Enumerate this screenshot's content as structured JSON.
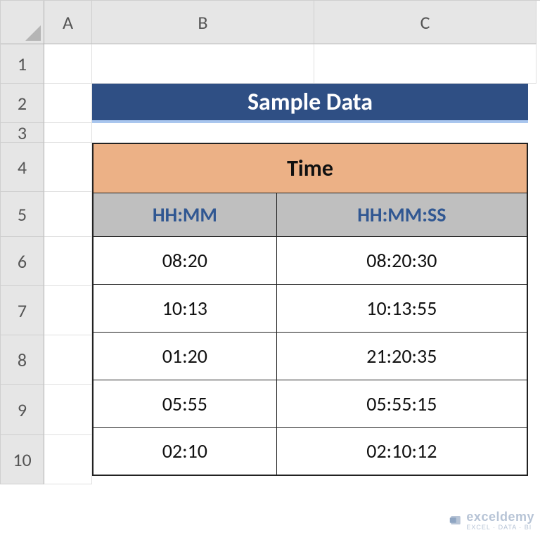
{
  "columns": [
    "A",
    "B",
    "C"
  ],
  "rows": [
    "1",
    "2",
    "3",
    "4",
    "5",
    "6",
    "7",
    "8",
    "9",
    "10"
  ],
  "title": "Sample Data",
  "table": {
    "header": "Time",
    "sub_headers": [
      "HH:MM",
      "HH:MM:SS"
    ],
    "data": [
      {
        "hhmm": "08:20",
        "hhmmss": "08:20:30"
      },
      {
        "hhmm": "10:13",
        "hhmmss": "10:13:55"
      },
      {
        "hhmm": "01:20",
        "hhmmss": "21:20:35"
      },
      {
        "hhmm": "05:55",
        "hhmmss": "05:55:15"
      },
      {
        "hhmm": "02:10",
        "hhmmss": "02:10:12"
      }
    ]
  },
  "watermark": {
    "brand": "exceldemy",
    "tagline": "EXCEL · DATA · BI"
  }
}
